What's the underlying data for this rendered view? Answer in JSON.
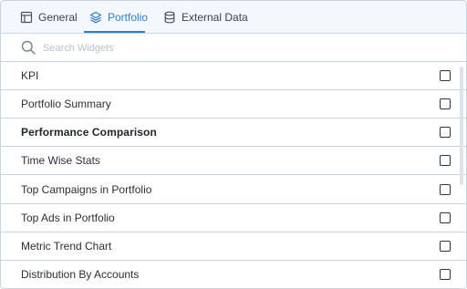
{
  "tabs": {
    "general": "General",
    "portfolio": "Portfolio",
    "external": "External Data",
    "active": "portfolio"
  },
  "search": {
    "placeholder": "Search Widgets",
    "value": ""
  },
  "widgets": [
    {
      "label": "KPI",
      "checked": false
    },
    {
      "label": "Portfolio Summary",
      "checked": false
    },
    {
      "label": "Performance Comparison",
      "checked": false
    },
    {
      "label": "Time Wise Stats",
      "checked": false
    },
    {
      "label": "Top Campaigns in Portfolio",
      "checked": false
    },
    {
      "label": "Top Ads in Portfolio",
      "checked": false
    },
    {
      "label": "Metric Trend Chart",
      "checked": false
    },
    {
      "label": "Distribution By Accounts",
      "checked": false
    }
  ],
  "colors": {
    "accent": "#2c80c9",
    "tabbar_bg": "#f4f7fb",
    "border": "#c9d4e3"
  },
  "icons": {
    "general": "layout-icon",
    "portfolio": "layers-icon",
    "external": "database-icon",
    "search": "search-icon"
  }
}
